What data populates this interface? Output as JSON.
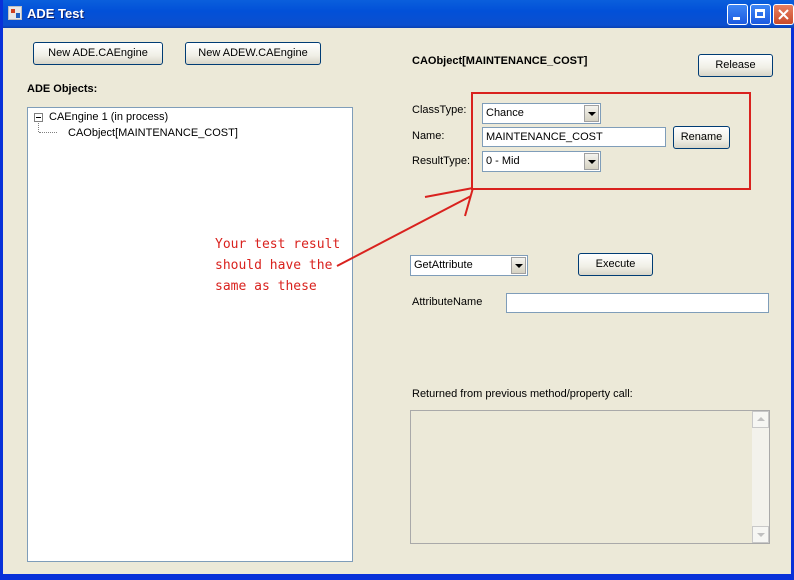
{
  "window": {
    "title": "ADE Test"
  },
  "left": {
    "new_ade_button": "New ADE.CAEngine",
    "new_adew_button": "New ADEW.CAEngine",
    "objects_label": "ADE Objects:",
    "tree": {
      "root": "CAEngine 1 (in process)",
      "child": "CAObject[MAINTENANCE_COST]"
    }
  },
  "right": {
    "object_title": "CAObject[MAINTENANCE_COST]",
    "release_button": "Release",
    "class_type_label": "ClassType:",
    "class_type_value": "Chance",
    "name_label": "Name:",
    "name_value": "MAINTENANCE_COST",
    "rename_button": "Rename",
    "result_type_label": "ResultType:",
    "result_type_value": "0 - Mid",
    "method_value": "GetAttribute",
    "execute_button": "Execute",
    "attribute_name_label": "AttributeName",
    "attribute_name_value": "",
    "returned_label": "Returned from previous method/property call:",
    "returned_value": ""
  },
  "annotation": {
    "lines": [
      "Your test result",
      "should have the",
      "same as these"
    ],
    "color": "#d9221e"
  }
}
